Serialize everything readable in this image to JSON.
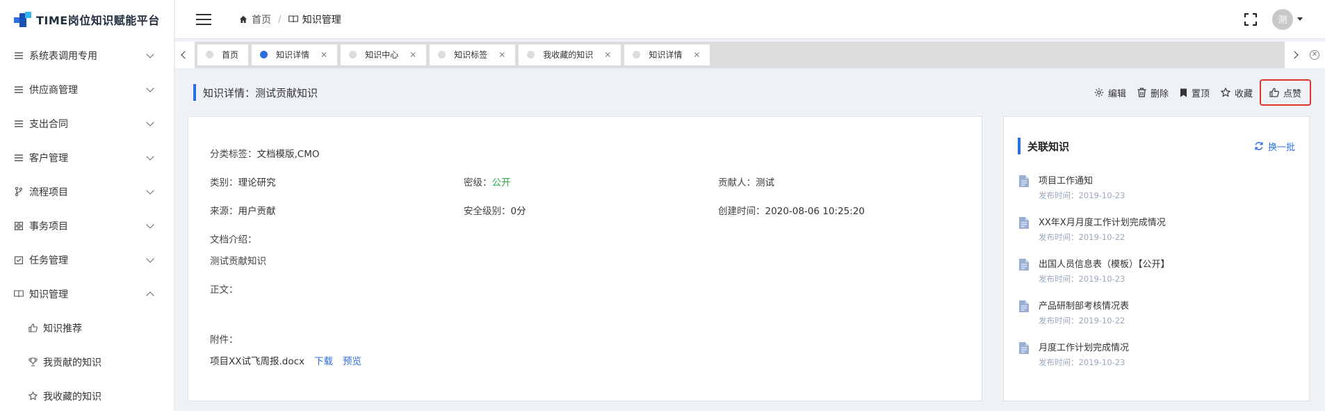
{
  "app": {
    "title": "TIME岗位知识赋能平台"
  },
  "sidebar": {
    "items": [
      {
        "label": "系统表调用专用",
        "icon": "list-icon",
        "expanded": false
      },
      {
        "label": "供应商管理",
        "icon": "list-icon",
        "expanded": false
      },
      {
        "label": "支出合同",
        "icon": "list-icon",
        "expanded": false
      },
      {
        "label": "客户管理",
        "icon": "list-icon",
        "expanded": false
      },
      {
        "label": "流程项目",
        "icon": "branch-icon",
        "expanded": false
      },
      {
        "label": "事务项目",
        "icon": "grid-icon",
        "expanded": false
      },
      {
        "label": "任务管理",
        "icon": "checkbox-icon",
        "expanded": false
      },
      {
        "label": "知识管理",
        "icon": "book-icon",
        "expanded": true
      }
    ],
    "sub_items": [
      {
        "label": "知识推荐",
        "icon": "thumb-up-icon"
      },
      {
        "label": "我贡献的知识",
        "icon": "trophy-icon"
      },
      {
        "label": "我收藏的知识",
        "icon": "star-icon"
      }
    ]
  },
  "header": {
    "breadcrumb": {
      "home": "首页",
      "sep": "/",
      "current": "知识管理"
    },
    "avatar_text": "测"
  },
  "tabs": [
    {
      "label": "首页",
      "active": false,
      "closable": false
    },
    {
      "label": "知识详情",
      "active": true,
      "closable": true
    },
    {
      "label": "知识中心",
      "active": false,
      "closable": true
    },
    {
      "label": "知识标签",
      "active": false,
      "closable": true
    },
    {
      "label": "我收藏的知识",
      "active": false,
      "closable": true
    },
    {
      "label": "知识详情",
      "active": false,
      "closable": true
    }
  ],
  "page": {
    "title": "知识详情：测试贡献知识",
    "actions": {
      "edit": "编辑",
      "delete": "删除",
      "pin": "置顶",
      "favorite": "收藏",
      "like": "点赞"
    }
  },
  "detail": {
    "tags_label": "分类标签：",
    "tags_value": "文档模版,CMO",
    "category_label": "类别：",
    "category_value": "理论研究",
    "secret_label": "密级：",
    "secret_value": "公开",
    "contributor_label": "贡献人：",
    "contributor_value": "测试",
    "source_label": "来源：",
    "source_value": "用户贡献",
    "security_label": "安全级别：",
    "security_value": "0分",
    "created_label": "创建时间：",
    "created_value": "2020-08-06 10:25:20",
    "intro_label": "文档介绍：",
    "intro_value": "测试贡献知识",
    "body_label": "正文：",
    "attach_label": "附件：",
    "attach_file": "项目XX试飞周报.docx",
    "download": "下载",
    "preview": "预览"
  },
  "related": {
    "title": "关联知识",
    "refresh": "换一批",
    "items": [
      {
        "name": "项目工作通知",
        "date": "发布时间：2019-10-23"
      },
      {
        "name": "XX年X月月度工作计划完成情况",
        "date": "发布时间：2019-10-22"
      },
      {
        "name": "出国人员信息表（模板）【公开】",
        "date": "发布时间：2019-10-23"
      },
      {
        "name": "产品研制部考核情况表",
        "date": "发布时间：2019-10-22"
      },
      {
        "name": "月度工作计划完成情况",
        "date": "发布时间：2019-10-23"
      }
    ]
  },
  "colors": {
    "accent": "#2f6fdd",
    "public": "#2fa84f",
    "highlight": "#e0332a"
  }
}
